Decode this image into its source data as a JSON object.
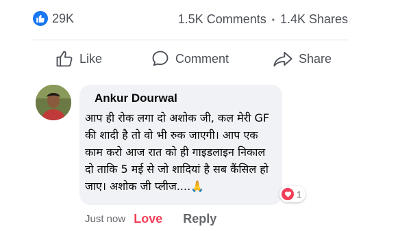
{
  "stats": {
    "likes": "29K",
    "comments": "1.5K Comments",
    "separator": "•",
    "shares": "1.4K Shares"
  },
  "actions": {
    "like_label": "Like",
    "comment_label": "Comment",
    "share_label": "Share"
  },
  "comment": {
    "author": "Ankur Dourwal",
    "lines": [
      "आप ही रोक लगा दो अशोक जी, कल मेरी GF",
      "की शादी है तो वो भी रुक जाएगी। आप एक",
      "काम करो आज रात को ही गाइडलाइन निकाल",
      "दो ताकि 5 मई से जो शादियां है सब कैंसिल हो",
      "जाए। अशोक जी प्लीज....🙏"
    ],
    "reaction_count": "1",
    "reaction_icon": "heart-icon"
  },
  "meta": {
    "time": "Just now",
    "love_label": "Love",
    "reply_label": "Reply"
  },
  "colors": {
    "like_blue": "#1877f2",
    "love_red": "#f33e58",
    "bubble_bg": "#f0f2f5",
    "muted_text": "#65676b"
  }
}
